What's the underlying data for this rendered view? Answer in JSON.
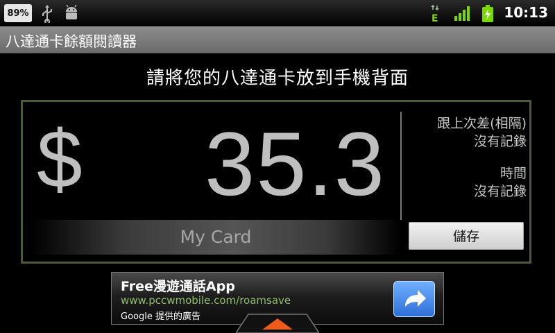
{
  "status_bar": {
    "battery_percent": "89%",
    "time": "10:13",
    "icons": [
      "usb-icon",
      "android-debug-icon",
      "edge-data-icon",
      "signal-icon",
      "battery-charging-icon"
    ]
  },
  "app": {
    "title": "八達通卡餘額閱讀器"
  },
  "main": {
    "instruction": "請將您的八達通卡放到手機背面",
    "currency_symbol": "$",
    "balance": "35.3",
    "card_name": "My Card",
    "difference_label": "跟上次差(相隔)",
    "difference_value": "沒有記錄",
    "time_label": "時間",
    "time_value": "沒有記錄",
    "save_label": "儲存"
  },
  "ad": {
    "title": "Free漫遊通話App",
    "url": "www.pccwmobile.com/roamsave",
    "footer": "Google 提供的廣告",
    "action_icon": "share-arrow-icon"
  },
  "colors": {
    "panel_border": "#4e5a3c",
    "ad_url": "#8fbf6a",
    "pulltab": "#f05a1a"
  }
}
